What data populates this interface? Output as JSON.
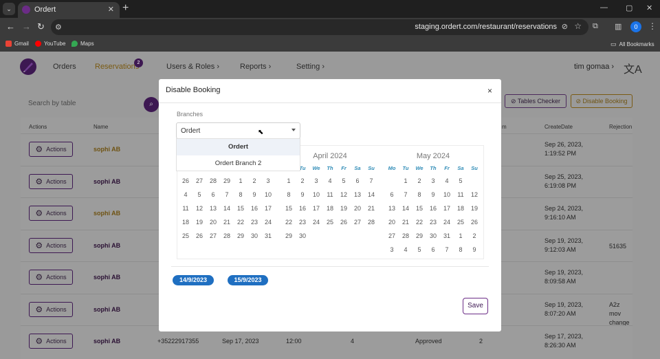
{
  "browser": {
    "tab_title": "Ordert",
    "url": "staging.ordert.com/restaurant/reservations",
    "profile_initial": "0",
    "bookmarks": [
      {
        "label": "Gmail",
        "color": "#ea4335"
      },
      {
        "label": "YouTube",
        "color": "#ff0000"
      },
      {
        "label": "Maps",
        "color": "#34a853"
      }
    ],
    "all_bookmarks": "All Bookmarks"
  },
  "app_nav": {
    "orders": "Orders",
    "reservations": "Reservations",
    "reservations_badge": "2",
    "users_roles": "Users & Roles",
    "reports": "Reports",
    "setting": "Setting",
    "user_name": "tim gomaa"
  },
  "toolbar": {
    "search_placeholder": "Search by table",
    "tables_checker": "Tables Checker",
    "disable_booking": "Disable Booking"
  },
  "table": {
    "headers": {
      "actions": "Actions",
      "name": "Name",
      "num": "m",
      "create_date": "CreateDate",
      "rejection": "Rejection"
    },
    "action_label": "Actions",
    "rows": [
      {
        "name": "sophi AB",
        "gold": true,
        "date1": "Sep 26, 2023,",
        "date2": "1:19:52 PM",
        "rej1": "",
        "rej2": ""
      },
      {
        "name": "sophi AB",
        "gold": false,
        "date1": "Sep 25, 2023,",
        "date2": "6:19:08 PM",
        "rej1": "",
        "rej2": ""
      },
      {
        "name": "sophi AB",
        "gold": true,
        "date1": "Sep 24, 2023,",
        "date2": "9:16:10 AM",
        "rej1": "",
        "rej2": ""
      },
      {
        "name": "sophi AB",
        "gold": false,
        "date1": "Sep 19, 2023,",
        "date2": "9:12:03 AM",
        "rej1": "51635",
        "rej2": ""
      },
      {
        "name": "sophi AB",
        "gold": false,
        "date1": "Sep 19, 2023,",
        "date2": "8:09:58 AM",
        "rej1": "",
        "rej2": ""
      },
      {
        "name": "sophi AB",
        "gold": false,
        "date1": "Sep 19, 2023,",
        "date2": "8:07:20 AM",
        "rej1": "A2z mov",
        "rej2": "change"
      },
      {
        "name": "sophi AB",
        "gold": false,
        "date1": "Sep 17, 2023,",
        "date2": "8:26:30 AM",
        "rej1": "",
        "rej2": ""
      }
    ],
    "last_row_extra": {
      "phone": "+35222917355",
      "date": "Sep 17, 2023",
      "time": "12:00",
      "guests": "4",
      "status": "Approved",
      "count": "2"
    }
  },
  "modal": {
    "title": "Disable Booking",
    "close": "×",
    "branches_label": "Branches",
    "branch_value": "Ordert",
    "options": [
      "Ordert",
      "Ordert Branch 2"
    ],
    "months": [
      {
        "title": "",
        "weekdays": [
          "",
          "Tu"
        ],
        "rows": [
          [
            "26",
            "27",
            "28",
            "29",
            "1",
            "2",
            "3"
          ],
          [
            "4",
            "5",
            "6",
            "7",
            "8",
            "9",
            "10"
          ],
          [
            "11",
            "12",
            "13",
            "14",
            "15",
            "16",
            "17"
          ],
          [
            "18",
            "19",
            "20",
            "21",
            "22",
            "23",
            "24"
          ],
          [
            "25",
            "26",
            "27",
            "28",
            "29",
            "30",
            "31"
          ]
        ]
      },
      {
        "title": "April 2024",
        "weekdays": [
          "Tu",
          "We",
          "Th",
          "Fr",
          "Sa",
          "Su"
        ],
        "rows": [
          [
            "1",
            "2",
            "3",
            "4",
            "5",
            "6",
            "7"
          ],
          [
            "8",
            "9",
            "10",
            "11",
            "12",
            "13",
            "14"
          ],
          [
            "15",
            "16",
            "17",
            "18",
            "19",
            "20",
            "21"
          ],
          [
            "22",
            "23",
            "24",
            "25",
            "26",
            "27",
            "28"
          ],
          [
            "29",
            "30",
            "",
            "",
            "",
            "",
            ""
          ]
        ]
      },
      {
        "title": "May 2024",
        "weekdays": [
          "Mo",
          "Tu",
          "We",
          "Th",
          "Fr",
          "Sa",
          "Su"
        ],
        "rows": [
          [
            "",
            "1",
            "2",
            "3",
            "4",
            "5",
            ""
          ],
          [
            "6",
            "7",
            "8",
            "9",
            "10",
            "11",
            "12"
          ],
          [
            "13",
            "14",
            "15",
            "16",
            "17",
            "18",
            "19"
          ],
          [
            "20",
            "21",
            "22",
            "23",
            "24",
            "25",
            "26"
          ],
          [
            "27",
            "28",
            "29",
            "30",
            "31",
            "1",
            "2"
          ],
          [
            "3",
            "4",
            "5",
            "6",
            "7",
            "8",
            "9"
          ]
        ]
      }
    ],
    "chips": [
      "14/9/2023",
      "15/9/2023"
    ],
    "save_label": "Save"
  }
}
